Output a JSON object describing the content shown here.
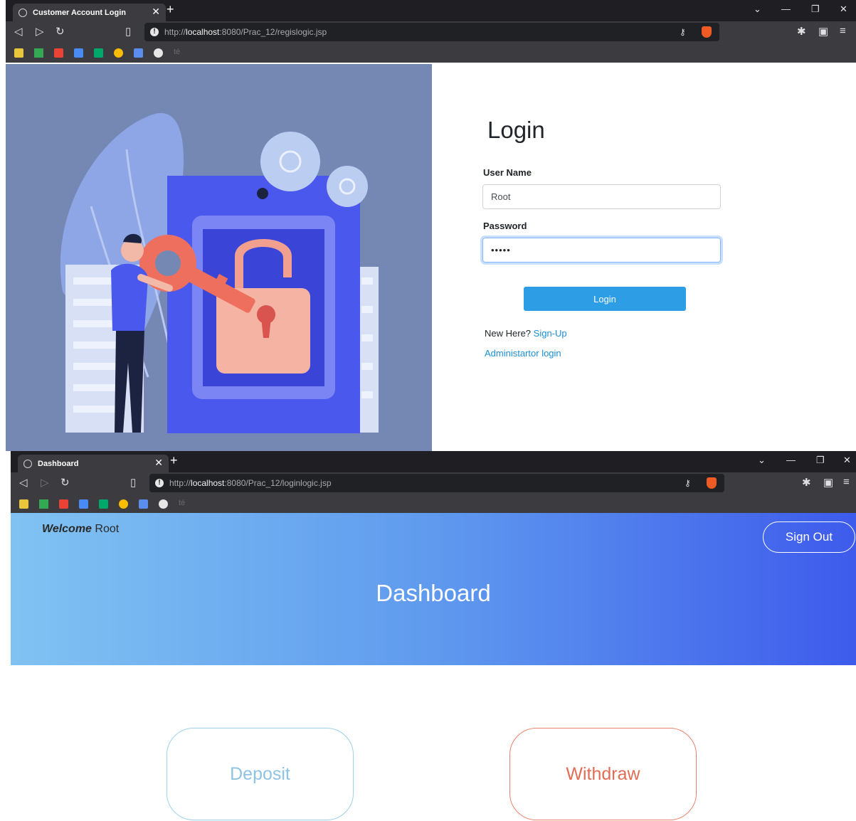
{
  "login_window": {
    "tab_title": "Customer Account Login",
    "url_prefix": "http://",
    "url_host": "localhost",
    "url_path": ":8080/Prac_12/regislogic.jsp",
    "bookmark_text": "té",
    "page": {
      "title": "Login",
      "username_label": "User Name",
      "username_value": "Root",
      "password_label": "Password",
      "password_value": "•••••",
      "login_button": "Login",
      "new_here_text": "New Here?",
      "signup_link": "Sign-Up",
      "admin_link": "Administartor login"
    }
  },
  "dashboard_window": {
    "tab_title": "Dashboard",
    "url_prefix": "http://",
    "url_host": "localhost",
    "url_path": ":8080/Prac_12/loginlogic.jsp",
    "bookmark_text": "té",
    "page": {
      "welcome_bold": "Welcome",
      "welcome_user": "Root",
      "signout_button": "Sign Out",
      "title": "Dashboard",
      "deposit_button": "Deposit",
      "withdraw_button": "Withdraw"
    }
  },
  "colors": {
    "chrome_dark": "#1f1f23",
    "chrome_bar": "#3b3b40",
    "illustration_bg": "#7488b3",
    "login_button": "#2d9de6",
    "link": "#1a8fd6",
    "hero_start": "#80c3f2",
    "hero_end": "#3e5bec",
    "deposit": "#8fc3e4",
    "withdraw": "#e36c55"
  },
  "icons": [
    "globe-icon",
    "close-icon",
    "new-tab-icon",
    "back-icon",
    "forward-icon",
    "reload-icon",
    "bookmark-icon",
    "info-icon",
    "key-icon",
    "brave-shield-icon",
    "extensions-icon",
    "wallet-icon",
    "menu-icon",
    "minimize-icon",
    "restore-icon",
    "tab-list-icon"
  ]
}
